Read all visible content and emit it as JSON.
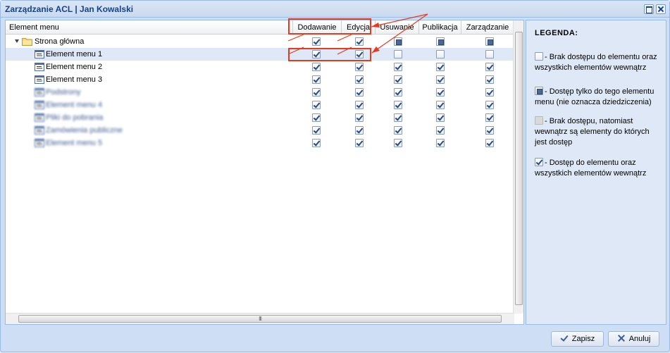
{
  "window": {
    "title": "Zarządzanie ACL | Jan Kowalski"
  },
  "grid": {
    "columns": [
      {
        "key": "name",
        "label": "Element menu"
      },
      {
        "key": "add",
        "label": "Dodawanie"
      },
      {
        "key": "edit",
        "label": "Edycja"
      },
      {
        "key": "delete",
        "label": "Usuwanie"
      },
      {
        "key": "publish",
        "label": "Publikacja"
      },
      {
        "key": "manage",
        "label": "Zarządzanie"
      }
    ],
    "rows": [
      {
        "label": "Strona główna",
        "level": 0,
        "type": "folder",
        "expanded": true,
        "blurred": false,
        "selected": false,
        "perms": [
          "checked",
          "checked",
          "partial",
          "partial",
          "partial"
        ]
      },
      {
        "label": "Element menu 1",
        "level": 1,
        "type": "page",
        "blurred": false,
        "selected": true,
        "perms": [
          "checked",
          "checked",
          "empty",
          "empty",
          "empty"
        ]
      },
      {
        "label": "Element menu 2",
        "level": 1,
        "type": "page",
        "blurred": false,
        "selected": false,
        "perms": [
          "checked",
          "checked",
          "checked",
          "checked",
          "checked"
        ]
      },
      {
        "label": "Element menu 3",
        "level": 1,
        "type": "page",
        "blurred": false,
        "selected": false,
        "perms": [
          "checked",
          "checked",
          "checked",
          "checked",
          "checked"
        ]
      },
      {
        "label": "Podstrony",
        "level": 1,
        "type": "page",
        "blurred": true,
        "selected": false,
        "perms": [
          "checked",
          "checked",
          "checked",
          "checked",
          "checked"
        ]
      },
      {
        "label": "Element menu 4",
        "level": 1,
        "type": "page",
        "blurred": true,
        "selected": false,
        "perms": [
          "checked",
          "checked",
          "checked",
          "checked",
          "checked"
        ]
      },
      {
        "label": "Pliki do pobrania",
        "level": 1,
        "type": "page",
        "blurred": true,
        "selected": false,
        "perms": [
          "checked",
          "checked",
          "checked",
          "checked",
          "checked"
        ]
      },
      {
        "label": "Zamówienia publiczne",
        "level": 1,
        "type": "page",
        "blurred": true,
        "selected": false,
        "perms": [
          "checked",
          "checked",
          "checked",
          "checked",
          "checked"
        ]
      },
      {
        "label": "Element menu 5",
        "level": 1,
        "type": "page",
        "blurred": true,
        "selected": false,
        "perms": [
          "checked",
          "checked",
          "checked",
          "checked",
          "checked"
        ]
      }
    ]
  },
  "legend": {
    "title": "LEGENDA:",
    "items": [
      {
        "state": "empty",
        "text": "- Brak dostępu do elementu oraz wszystkich elementów wewnątrz"
      },
      {
        "state": "partial",
        "text": "- Dostęp tylko do tego elementu menu (nie oznacza dziedziczenia)"
      },
      {
        "state": "gray",
        "text": "- Brak dostępu, natomiast wewnątrz są elementy do których jest dostęp"
      },
      {
        "state": "checked",
        "text": "- Dostęp do elementu oraz wszystkich elementów wewnątrz"
      }
    ]
  },
  "buttons": {
    "save": "Zapisz",
    "cancel": "Anuluj"
  },
  "scroll": {
    "grip": "III"
  },
  "colors": {
    "title_text": "#15428b",
    "annotation": "#e53a1e",
    "selected_row": "#dfe8f6",
    "border": "#99bbe8"
  }
}
